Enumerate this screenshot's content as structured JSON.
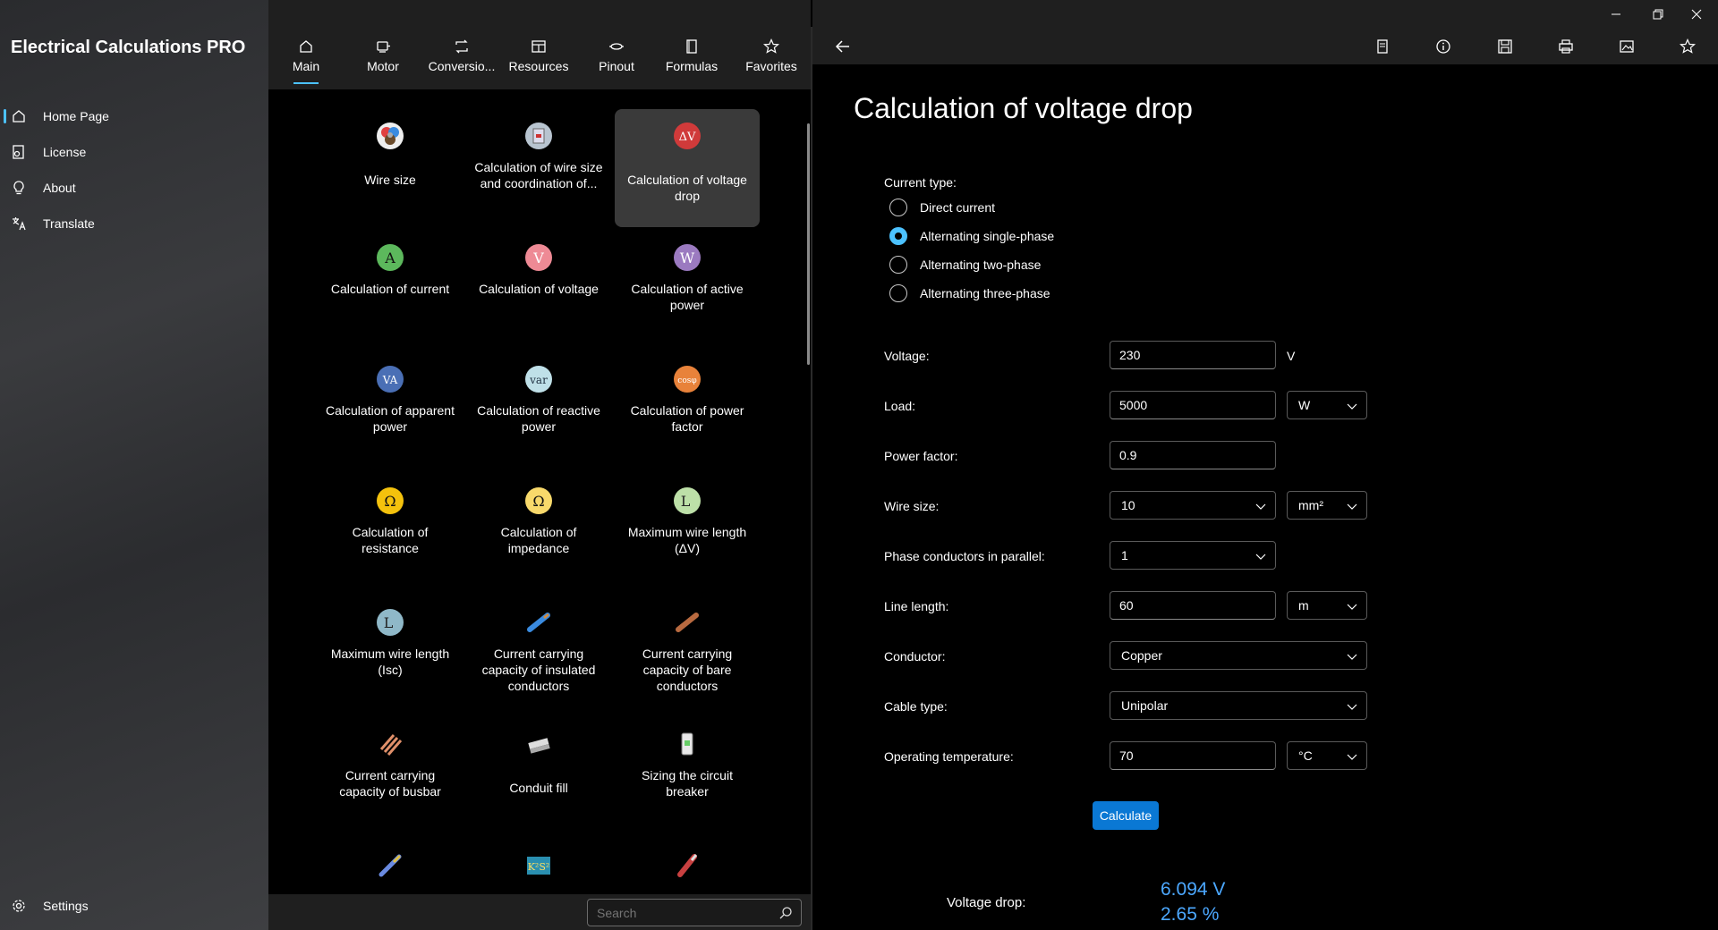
{
  "app": {
    "title": "Electrical Calculations PRO"
  },
  "sidebar": {
    "items": [
      {
        "label": "Home Page"
      },
      {
        "label": "License"
      },
      {
        "label": "About"
      },
      {
        "label": "Translate"
      }
    ],
    "settings_label": "Settings"
  },
  "tabs": [
    {
      "label": "Main"
    },
    {
      "label": "Motor"
    },
    {
      "label": "Conversio..."
    },
    {
      "label": "Resources"
    },
    {
      "label": "Pinout"
    },
    {
      "label": "Formulas"
    },
    {
      "label": "Favorites"
    }
  ],
  "tiles": [
    {
      "label": "Wire size"
    },
    {
      "label": "Calculation of wire size and coordination of..."
    },
    {
      "label": "Calculation of voltage drop"
    },
    {
      "label": "Calculation of current",
      "glyph": "A"
    },
    {
      "label": "Calculation of voltage",
      "glyph": "V"
    },
    {
      "label": "Calculation of active power",
      "glyph": "W"
    },
    {
      "label": "Calculation of apparent power",
      "glyph": "VA"
    },
    {
      "label": "Calculation of reactive power",
      "glyph": "var"
    },
    {
      "label": "Calculation of power factor",
      "glyph": "cosφ"
    },
    {
      "label": "Calculation of resistance",
      "glyph": "Ω"
    },
    {
      "label": "Calculation of impedance",
      "glyph": "Ω"
    },
    {
      "label": "Maximum wire length (ΔV)",
      "glyph": "L"
    },
    {
      "label": "Maximum wire length (Isc)",
      "glyph": "L"
    },
    {
      "label": "Current carrying capacity of insulated conductors"
    },
    {
      "label": "Current carrying capacity of bare conductors"
    },
    {
      "label": "Current carrying capacity of busbar"
    },
    {
      "label": "Conduit fill"
    },
    {
      "label": "Sizing the circuit breaker"
    },
    {
      "label": ""
    },
    {
      "label": "",
      "glyph": "K²S²"
    },
    {
      "label": ""
    }
  ],
  "tile_glyphs": {
    "voltage_drop": "ΔV"
  },
  "search": {
    "placeholder": "Search"
  },
  "page": {
    "title": "Calculation of voltage drop"
  },
  "form": {
    "current_type_label": "Current type:",
    "current_types": [
      {
        "label": "Direct current",
        "selected": false
      },
      {
        "label": "Alternating single-phase",
        "selected": true
      },
      {
        "label": "Alternating two-phase",
        "selected": false
      },
      {
        "label": "Alternating three-phase",
        "selected": false
      }
    ],
    "voltage": {
      "label": "Voltage:",
      "value": "230",
      "unit": "V"
    },
    "load": {
      "label": "Load:",
      "value": "5000",
      "unit": "W"
    },
    "power_factor": {
      "label": "Power factor:",
      "value": "0.9"
    },
    "wire_size": {
      "label": "Wire size:",
      "value": "10",
      "unit": "mm²"
    },
    "phase_conductors": {
      "label": "Phase conductors in parallel:",
      "value": "1"
    },
    "line_length": {
      "label": "Line length:",
      "value": "60",
      "unit": "m"
    },
    "conductor": {
      "label": "Conductor:",
      "value": "Copper"
    },
    "cable_type": {
      "label": "Cable type:",
      "value": "Unipolar"
    },
    "operating_temperature": {
      "label": "Operating temperature:",
      "value": "70",
      "unit": "°C"
    },
    "calculate_label": "Calculate"
  },
  "result": {
    "label": "Voltage drop:",
    "value_v": "6.094 V",
    "value_pct": "2.65 %"
  },
  "colors": {
    "accent": "#4cc2ff",
    "button": "#0a78d4",
    "result": "#4ca8ff"
  }
}
